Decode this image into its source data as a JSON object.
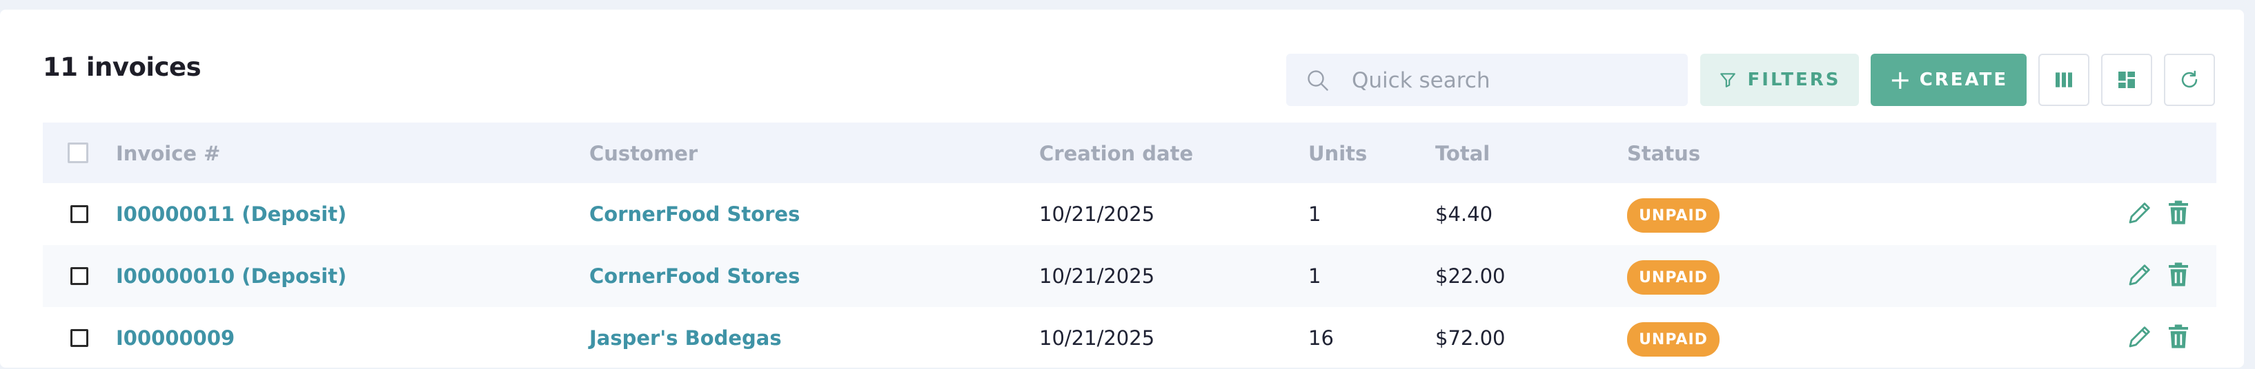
{
  "header": {
    "title": "11 invoices"
  },
  "search": {
    "placeholder": "Quick search",
    "value": ""
  },
  "toolbar": {
    "filters_label": "FILTERS",
    "create_label": "CREATE",
    "columns_icon": "columns-icon",
    "layout_icon": "dashboard-layout-icon",
    "refresh_icon": "refresh-icon"
  },
  "table": {
    "columns": [
      "Invoice #",
      "Customer",
      "Creation date",
      "Units",
      "Total",
      "Status"
    ],
    "rows": [
      {
        "invoice": "I00000011 (Deposit)",
        "customer": "CornerFood Stores",
        "date": "10/21/2025",
        "units": "1",
        "total": "$4.40",
        "status": "UNPAID"
      },
      {
        "invoice": "I00000010 (Deposit)",
        "customer": "CornerFood Stores",
        "date": "10/21/2025",
        "units": "1",
        "total": "$22.00",
        "status": "UNPAID"
      },
      {
        "invoice": "I00000009",
        "customer": "Jasper's Bodegas",
        "date": "10/21/2025",
        "units": "16",
        "total": "$72.00",
        "status": "UNPAID"
      }
    ]
  },
  "colors": {
    "accent": "#5aae97",
    "link": "#3f93a6",
    "status_unpaid": "#f1a13b",
    "header_bg": "#f1f4fb"
  }
}
